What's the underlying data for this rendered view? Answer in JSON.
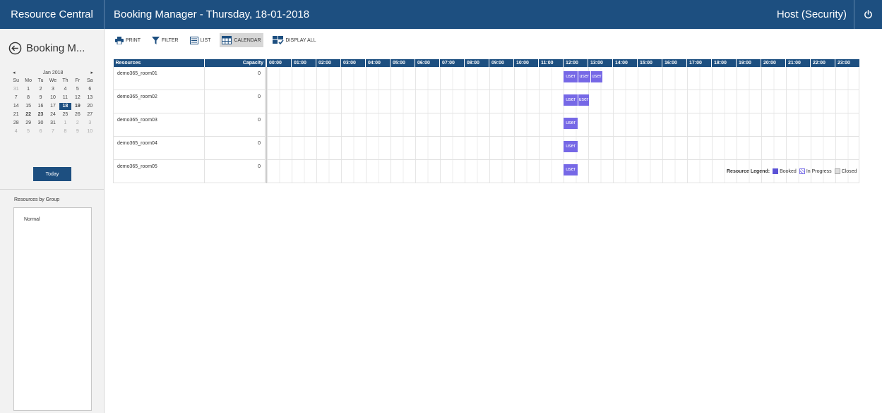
{
  "app": {
    "brand": "Resource Central",
    "title": "Booking Manager - Thursday, 18-01-2018",
    "user": "Host (Security)"
  },
  "sidebar": {
    "title": "Booking M...",
    "calendar": {
      "month": "Jan 2018",
      "days_of_week": [
        "Su",
        "Mo",
        "Tu",
        "We",
        "Th",
        "Fr",
        "Sa"
      ],
      "weeks": [
        [
          "31",
          "1",
          "2",
          "3",
          "4",
          "5",
          "6"
        ],
        [
          "7",
          "8",
          "9",
          "10",
          "11",
          "12",
          "13"
        ],
        [
          "14",
          "15",
          "16",
          "17",
          "18",
          "19",
          "20"
        ],
        [
          "21",
          "22",
          "23",
          "24",
          "25",
          "26",
          "27"
        ],
        [
          "28",
          "29",
          "30",
          "31",
          "1",
          "2",
          "3"
        ],
        [
          "4",
          "5",
          "6",
          "7",
          "8",
          "9",
          "10"
        ]
      ],
      "selected": "18"
    },
    "today_label": "Today",
    "groups_label": "Resources by Group",
    "groups": [
      "Normal"
    ]
  },
  "toolbar": {
    "print": "PRINT",
    "filter": "FILTER",
    "list": "LIST",
    "calendar": "CALENDAR",
    "display_all": "DISPLAY ALL"
  },
  "grid": {
    "headers": {
      "resources": "Resources",
      "capacity": "Capacity"
    },
    "hours": [
      "00:00",
      "01:00",
      "02:00",
      "03:00",
      "04:00",
      "05:00",
      "06:00",
      "07:00",
      "08:00",
      "09:00",
      "10:00",
      "11:00",
      "12:00",
      "13:00",
      "14:00",
      "15:00",
      "16:00",
      "17:00",
      "18:00",
      "19:00",
      "20:00",
      "21:00",
      "22:00",
      "23:00"
    ],
    "rows": [
      {
        "name": "demo365_room01",
        "capacity": "0",
        "bookings": [
          {
            "label": "user",
            "start": 12.0,
            "end": 12.6
          },
          {
            "label": "user",
            "start": 12.6,
            "end": 13.1
          },
          {
            "label": "user",
            "start": 13.1,
            "end": 13.6
          }
        ]
      },
      {
        "name": "demo365_room02",
        "capacity": "0",
        "bookings": [
          {
            "label": "user",
            "start": 12.0,
            "end": 12.6
          },
          {
            "label": "user",
            "start": 12.6,
            "end": 13.05
          }
        ]
      },
      {
        "name": "demo365_room03",
        "capacity": "0",
        "bookings": [
          {
            "label": "user",
            "start": 12.0,
            "end": 12.6
          }
        ]
      },
      {
        "name": "demo365_room04",
        "capacity": "0",
        "bookings": [
          {
            "label": "user",
            "start": 12.0,
            "end": 12.6
          }
        ]
      },
      {
        "name": "demo365_room05",
        "capacity": "0",
        "bookings": [
          {
            "label": "user",
            "start": 12.0,
            "end": 12.6
          }
        ]
      }
    ]
  },
  "legend": {
    "label": "Resource Legend:",
    "booked": "Booked",
    "in_progress": "In Progress",
    "closed": "Closed"
  },
  "colors": {
    "header": "#1d4f80",
    "booking": "#7668e6",
    "booked_swatch": "#5b52d6"
  },
  "icons": {
    "back": "circle-arrow-left-icon",
    "power": "power-icon",
    "print": "printer-icon",
    "filter": "funnel-icon",
    "list": "list-icon",
    "calendar": "calendar-grid-icon",
    "display_all": "display-all-icon"
  }
}
